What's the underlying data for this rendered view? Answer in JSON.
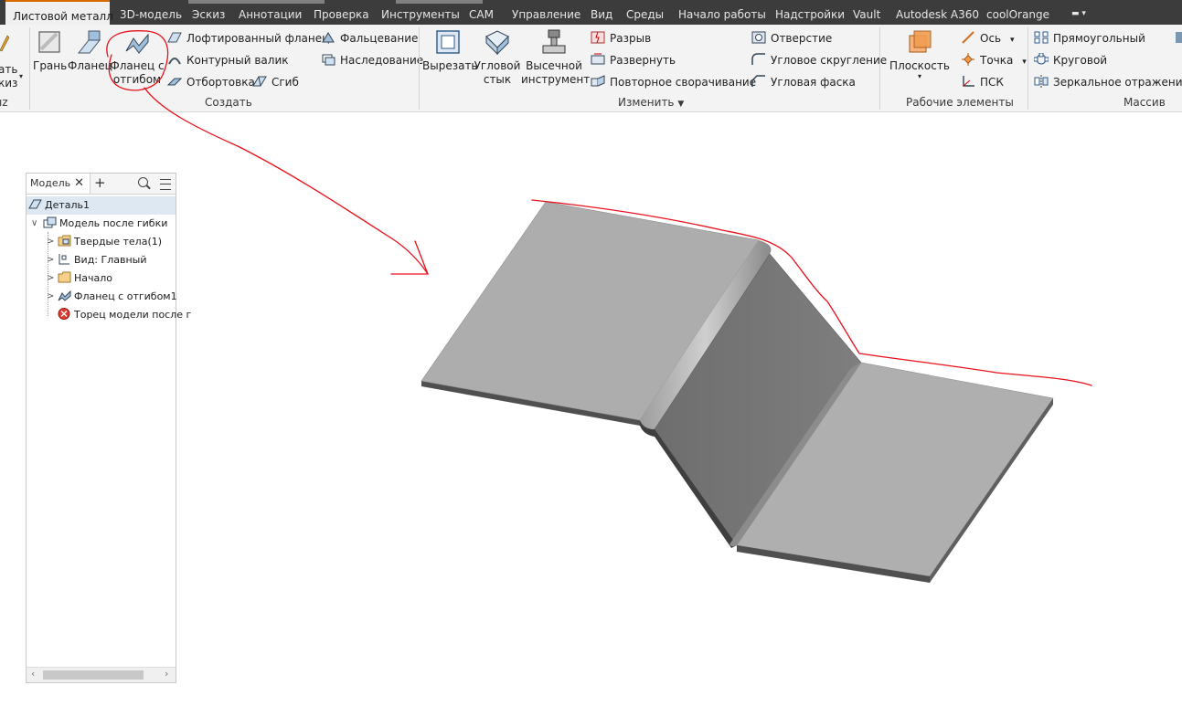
{
  "tabs": [
    {
      "label": "Листовой металл",
      "active": true
    },
    {
      "label": "3D-модель"
    },
    {
      "label": "Эскиз"
    },
    {
      "label": "Аннотации"
    },
    {
      "label": "Проверка"
    },
    {
      "label": "Инструменты"
    },
    {
      "label": "CAM"
    },
    {
      "label": "Управление"
    },
    {
      "label": "Вид"
    },
    {
      "label": "Среды"
    },
    {
      "label": "Начало работы"
    },
    {
      "label": "Надстройки"
    },
    {
      "label": "Vault"
    },
    {
      "label": "Autodesk A360"
    },
    {
      "label": "coolOrange"
    }
  ],
  "ribbon": {
    "sketch_partial": {
      "line1": "ать",
      "line2": "киз",
      "panel": "ız"
    },
    "create": {
      "face": "Грань",
      "flange": "Фланец",
      "contour_flange": "Фланец с отгибом",
      "lofted_flange": "Лофтированный фланец",
      "contour_roll": "Контурный валик",
      "hem": "Отбортовка",
      "bend": "Сгиб",
      "fold": "Фальцевание",
      "derive": "Наследование",
      "panel_label": "Создать"
    },
    "modify": {
      "cut": "Вырезать",
      "corner_seam": "Угловой стык",
      "punch_tool": "Высечной инструмент",
      "rip": "Разрыв",
      "unfold": "Развернуть",
      "refold": "Повторное сворачивание",
      "hole": "Отверстие",
      "corner_round": "Угловое скругление",
      "corner_chamfer": "Угловая фаска",
      "panel_label": "Изменить"
    },
    "work_features": {
      "plane": "Плоскость",
      "axis": "Ось",
      "point": "Точка",
      "ucs": "ПСК",
      "panel_label": "Рабочие элементы"
    },
    "pattern": {
      "rectangular": "Прямоугольный",
      "circular": "Круговой",
      "mirror": "Зеркальное отражение",
      "panel_label": "Массив"
    }
  },
  "browser": {
    "tab_label": "Модель",
    "nodes": [
      {
        "label": "Деталь1",
        "selected": true
      },
      {
        "label": "Модель после гибки"
      },
      {
        "label": "Твердые тела(1)"
      },
      {
        "label": "Вид: Главный"
      },
      {
        "label": "Начало"
      },
      {
        "label": "Фланец с отгибом1"
      },
      {
        "label": "Торец модели после г"
      }
    ]
  },
  "colors": {
    "tab_bar": "#3c3c3c",
    "active_tab_accent": "#d96a00",
    "ribbon_bg": "#f3f3f3",
    "annotation_red": "#e8101a",
    "sheet_light": "#adadad",
    "sheet_dark": "#737373",
    "sheet_edge": "#4f4f4f"
  }
}
